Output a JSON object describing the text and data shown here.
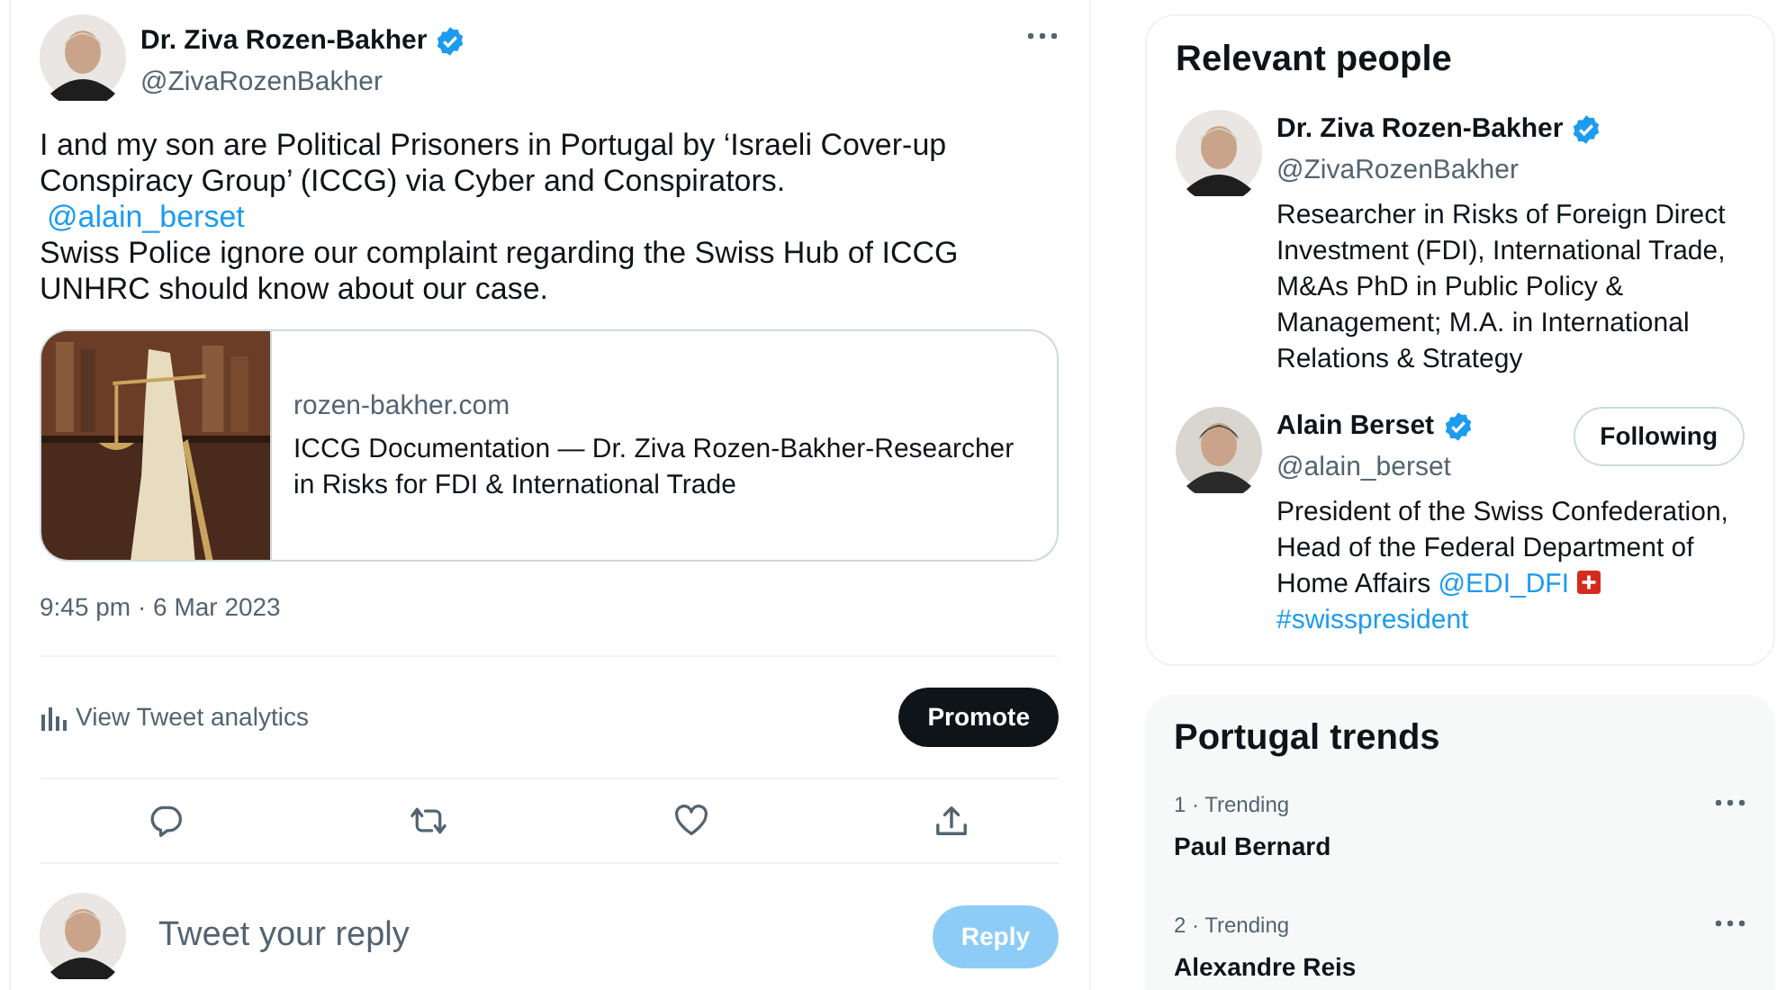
{
  "tweet": {
    "author": {
      "name": "Dr. Ziva Rozen-Bakher",
      "handle": "@ZivaRozenBakher",
      "verified": true
    },
    "body": [
      {
        "kind": "text",
        "text": "I and my son are Political Prisoners in Portugal by ‘Israeli Cover-up Conspiracy Group’ (ICCG) via Cyber and Conspirators."
      },
      {
        "kind": "mention",
        "text": "@alain_berset"
      },
      {
        "kind": "text",
        "text": "Swiss Police ignore our complaint regarding the Swiss Hub of ICCG"
      },
      {
        "kind": "text",
        "text": "UNHRC should know about our case."
      }
    ],
    "card": {
      "domain": "rozen-bakher.com",
      "title": "ICCG Documentation — Dr. Ziva Rozen-Bakher-Researcher in Risks for FDI & International Trade"
    },
    "timestamp": "9:45 pm · 6 Mar 2023",
    "analytics": "View Tweet analytics",
    "promote": "Promote",
    "reply": {
      "placeholder": "Tweet your reply",
      "button": "Reply",
      "disabled": true
    }
  },
  "relevant_people": {
    "title": "Relevant people",
    "people": [
      {
        "name": "Dr. Ziva Rozen-Bakher",
        "handle": "@ZivaRozenBakher",
        "verified": true,
        "bio": [
          {
            "kind": "text",
            "text": "Researcher in Risks of Foreign Direct Investment (FDI), International Trade, M&As PhD in Public Policy & Management; M.A. in International Relations & Strategy"
          }
        ]
      },
      {
        "name": "Alain Berset",
        "handle": "@alain_berset",
        "verified": true,
        "follow": "Following",
        "bio": [
          {
            "kind": "text",
            "text": "President of the Swiss Confederation, Head of the Federal Department of Home Affairs "
          },
          {
            "kind": "link",
            "text": "@EDI_DFI"
          },
          {
            "kind": "flag"
          },
          {
            "kind": "link",
            "text": "#swisspresident"
          }
        ]
      }
    ]
  },
  "trends": {
    "title": "Portugal trends",
    "items": [
      {
        "meta": "1 · Trending",
        "name": "Paul Bernard"
      },
      {
        "meta": "2 · Trending",
        "name": "Alexandre Reis"
      }
    ]
  }
}
